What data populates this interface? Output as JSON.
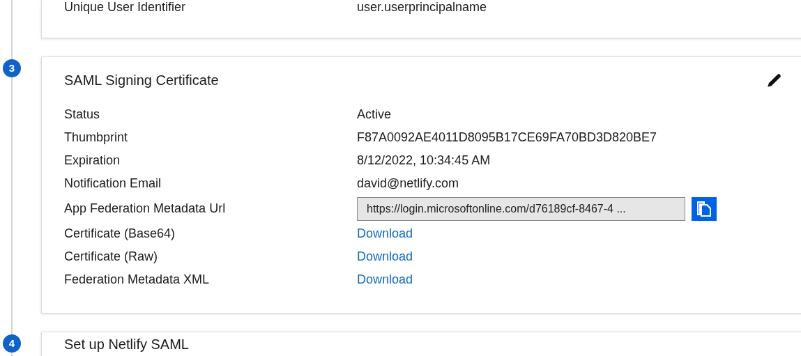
{
  "previous_card": {
    "rows": [
      {
        "label": "Unique User Identifier",
        "value": "user.userprincipalname"
      }
    ]
  },
  "signing_certificate": {
    "step": "3",
    "title": "SAML Signing Certificate",
    "rows": [
      {
        "kind": "text",
        "label": "Status",
        "value": "Active"
      },
      {
        "kind": "text",
        "label": "Thumbprint",
        "value": "F87A0092AE4011D8095B17CE69FA70BD3D820BE7"
      },
      {
        "kind": "text",
        "label": "Expiration",
        "value": "8/12/2022, 10:34:45 AM"
      },
      {
        "kind": "text",
        "label": "Notification Email",
        "value": "david@netlify.com"
      },
      {
        "kind": "field",
        "label": "App Federation Metadata Url",
        "value": "https://login.microsoftonline.com/d76189cf-8467-4 ..."
      },
      {
        "kind": "link",
        "label": "Certificate (Base64)",
        "value": "Download"
      },
      {
        "kind": "link",
        "label": "Certificate (Raw)",
        "value": "Download"
      },
      {
        "kind": "link",
        "label": "Federation Metadata XML",
        "value": "Download"
      }
    ]
  },
  "next_step": {
    "step": "4",
    "title": "Set up Netlify SAML"
  }
}
